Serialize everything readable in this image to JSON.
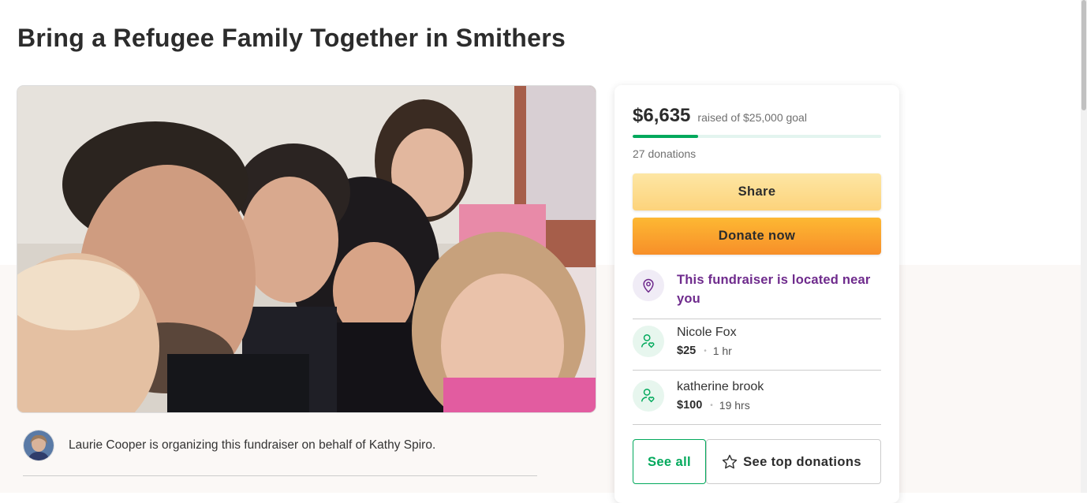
{
  "page": {
    "title": "Bring a Refugee Family Together in Smithers"
  },
  "organizer": {
    "text": "Laurie Cooper is organizing this fundraiser on behalf of Kathy Spiro."
  },
  "donation_card": {
    "amount": "$6,635",
    "goal_text": "raised of $25,000 goal",
    "progress_fraction": 0.265,
    "donations_count": "27 donations",
    "share_label": "Share",
    "donate_label": "Donate now",
    "nearby_text": "This fundraiser is located near you",
    "donors": [
      {
        "name": "Nicole Fox",
        "amount": "$25",
        "time": "1 hr"
      },
      {
        "name": "katherine brook",
        "amount": "$100",
        "time": "19 hrs"
      }
    ],
    "see_all_label": "See all",
    "see_top_label": "See top donations"
  },
  "icons": {
    "location": "location-pin-icon",
    "donor": "person-heart-icon",
    "star": "star-icon"
  },
  "colors": {
    "brand_green": "#02a95c",
    "purple": "#6e2a8c",
    "share_yellow": "#fdd37b",
    "donate_orange": "#f78f29"
  }
}
